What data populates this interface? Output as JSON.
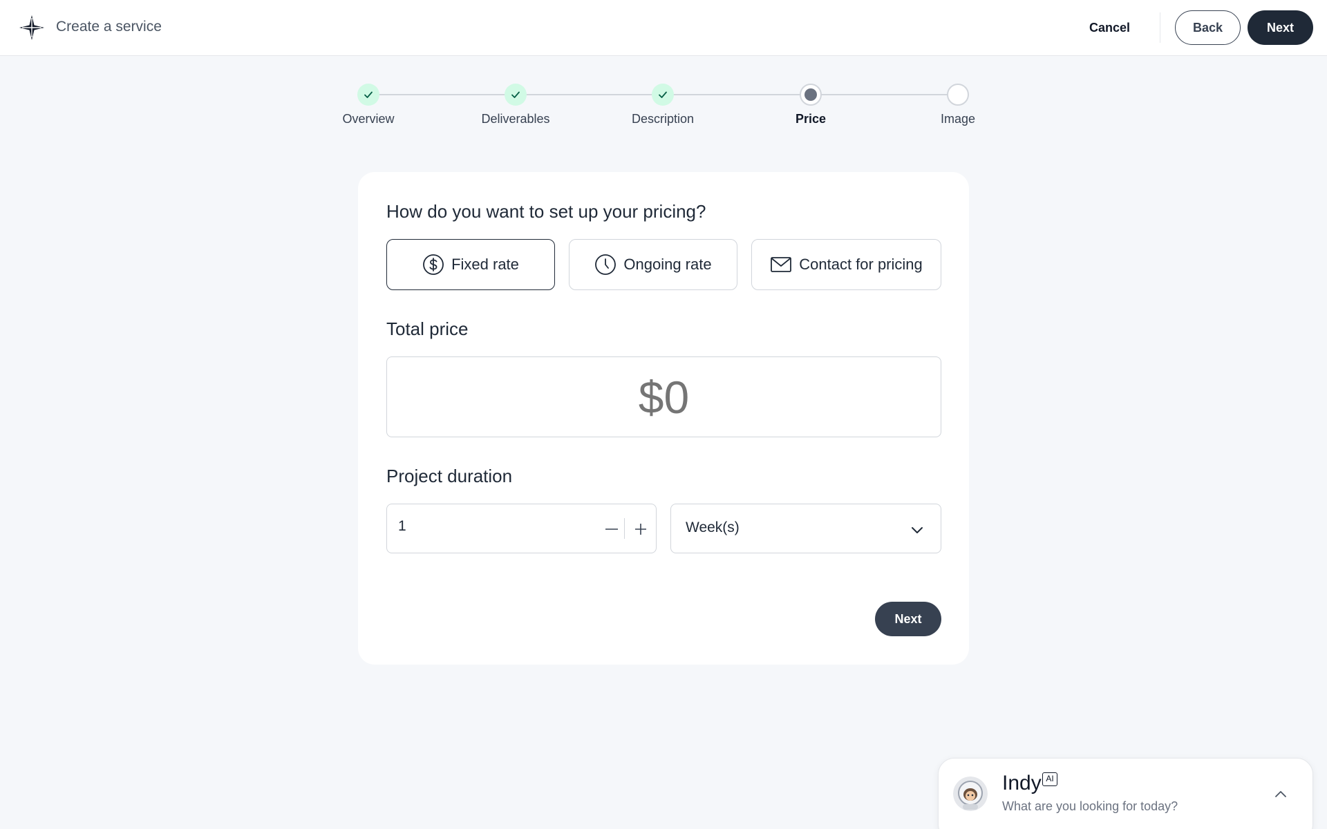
{
  "header": {
    "title": "Create a service",
    "cancel_label": "Cancel",
    "back_label": "Back",
    "next_label": "Next"
  },
  "stepper": {
    "steps": [
      {
        "label": "Overview",
        "status": "done"
      },
      {
        "label": "Deliverables",
        "status": "done"
      },
      {
        "label": "Description",
        "status": "done"
      },
      {
        "label": "Price",
        "status": "active"
      },
      {
        "label": "Image",
        "status": "todo"
      }
    ]
  },
  "pricing": {
    "question": "How do you want to set up your pricing?",
    "options": [
      {
        "label": "Fixed rate",
        "icon": "dollar-circle-icon",
        "selected": true
      },
      {
        "label": "Ongoing rate",
        "icon": "clock-icon",
        "selected": false
      },
      {
        "label": "Contact for pricing",
        "icon": "mail-icon",
        "selected": false
      }
    ],
    "total_price_label": "Total price",
    "total_price_placeholder": "$0",
    "duration_label": "Project duration",
    "duration_value": "1",
    "duration_unit": "Week(s)",
    "next_label": "Next"
  },
  "chat": {
    "name": "Indy",
    "badge": "AI",
    "prompt": "What are you looking for today?"
  },
  "colors": {
    "primary_dark": "#1f2937",
    "step_done_bg": "#d1fae5",
    "step_done_check": "#065f46",
    "page_bg": "#f5f7fa"
  }
}
